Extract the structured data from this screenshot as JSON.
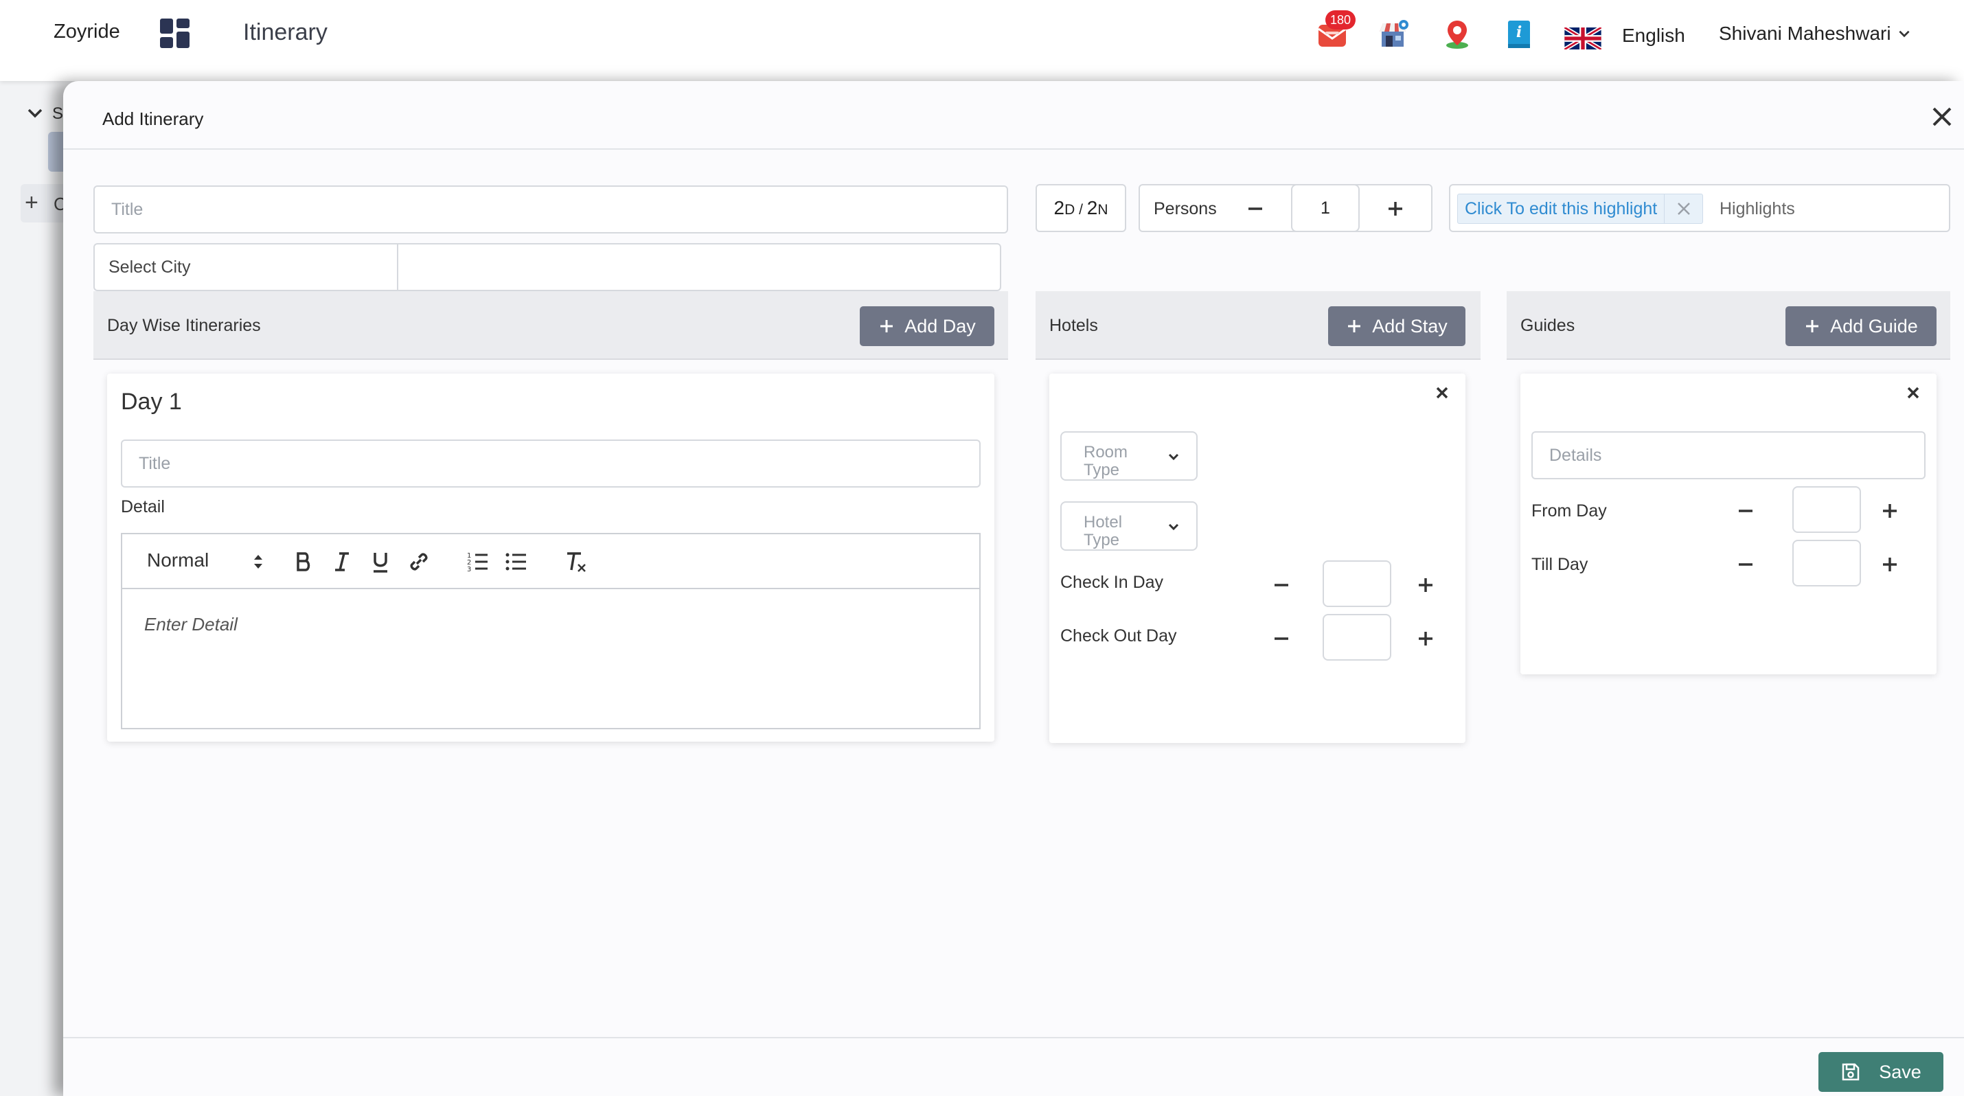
{
  "topbar": {
    "brand": "Zoyride",
    "page_title": "Itinerary",
    "notification_count": "180",
    "language": "English",
    "user_name": "Shivani Maheshwari"
  },
  "background": {
    "sidebar_letter": "S",
    "add_letter": "C"
  },
  "modal": {
    "title": "Add Itinerary",
    "title_placeholder": "Title",
    "city_placeholder": "Select City",
    "duration": {
      "days": "2",
      "day_unit": "D",
      "sep": " / ",
      "nights": "2",
      "night_unit": "N"
    },
    "persons": {
      "label": "Persons",
      "value": "1"
    },
    "highlight_chip": "Click To edit this highlight",
    "highlights_label": "Highlights",
    "save_label": "Save"
  },
  "day_section": {
    "title": "Day Wise Itineraries",
    "add_label": "Add Day",
    "day": {
      "name": "Day 1",
      "title_placeholder": "Title",
      "detail_label": "Detail",
      "format": "Normal",
      "editor_placeholder": "Enter Detail"
    }
  },
  "hotel_section": {
    "title": "Hotels",
    "add_label": "Add Stay",
    "room_type": "Room Type",
    "hotel_type": "Hotel Type",
    "check_in": "Check In Day",
    "check_out": "Check Out Day"
  },
  "guide_section": {
    "title": "Guides",
    "add_label": "Add Guide",
    "details_placeholder": "Details",
    "from_day": "From Day",
    "till_day": "Till Day"
  },
  "colors": {
    "accent_button": "#6f7586",
    "save_button": "#3f7f75",
    "chip_text": "#2f8bd1",
    "badge": "#e3262e"
  }
}
